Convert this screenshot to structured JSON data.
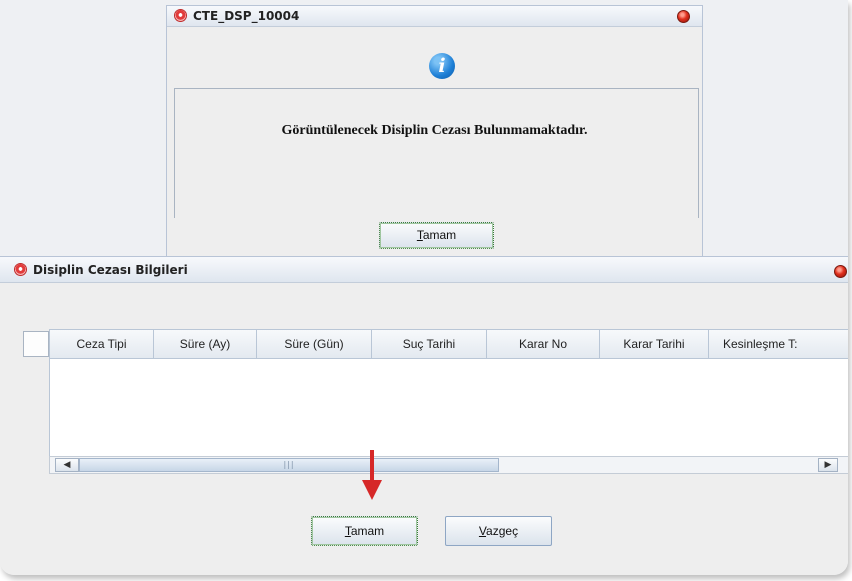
{
  "message_dialog": {
    "title": "CTE_DSP_10004",
    "message": "Görüntülenecek Disiplin Cezası Bulunmamaktadır.",
    "ok_button": {
      "mnemonic": "T",
      "rest": "amam"
    }
  },
  "main_dialog": {
    "title": "Disiplin Cezası Bilgileri",
    "columns": [
      "Ceza Tipi",
      "Süre (Ay)",
      "Süre (Gün)",
      "Suç Tarihi",
      "Karar No",
      "Karar Tarihi",
      "Kesinleşme T:"
    ],
    "ok_button": {
      "mnemonic": "T",
      "rest": "amam"
    },
    "cancel_button": {
      "mnemonic": "V",
      "rest": "azgeç"
    }
  },
  "colors": {
    "info_icon": "#1d7fd6",
    "arrow": "#d62828",
    "close_button": "#e0301e"
  }
}
